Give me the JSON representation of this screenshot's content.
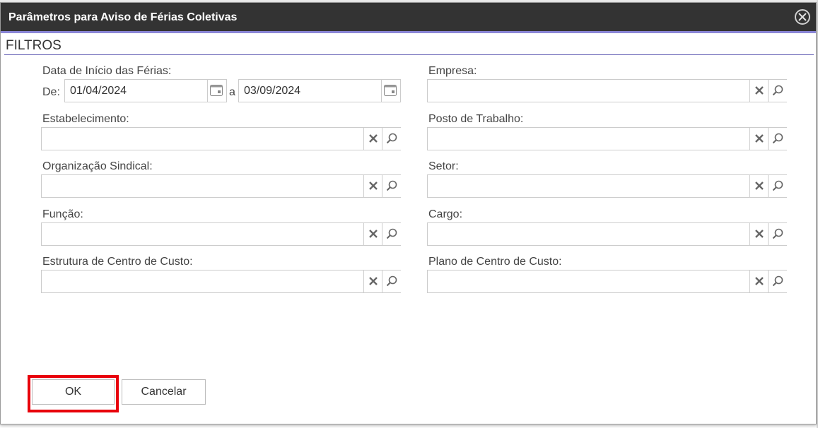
{
  "dialog": {
    "title": "Parâmetros para Aviso de Férias Coletivas",
    "close_icon": "close-circle-icon"
  },
  "section": {
    "title": "FILTROS"
  },
  "date_range": {
    "label": "Data de Início das Férias:",
    "from_label": "De:",
    "from_value": "01/04/2024",
    "to_label": "a",
    "to_value": "03/09/2024",
    "icon": "calendar-icon"
  },
  "filters": {
    "empresa": {
      "label": "Empresa:",
      "value": ""
    },
    "estabelecimento": {
      "label": "Estabelecimento:",
      "value": ""
    },
    "posto": {
      "label": "Posto de Trabalho:",
      "value": ""
    },
    "organizacao": {
      "label": "Organização Sindical:",
      "value": ""
    },
    "setor": {
      "label": "Setor:",
      "value": ""
    },
    "funcao": {
      "label": "Função:",
      "value": ""
    },
    "cargo": {
      "label": "Cargo:",
      "value": ""
    },
    "estrutura": {
      "label": "Estrutura de Centro de Custo:",
      "value": ""
    },
    "plano": {
      "label": "Plano de Centro de Custo:",
      "value": ""
    }
  },
  "icons": {
    "clear": "clear-x-icon",
    "search": "magnifier-icon"
  },
  "buttons": {
    "ok": "OK",
    "cancel": "Cancelar"
  },
  "colors": {
    "titlebar": "#333333",
    "accent": "#6b67b8",
    "highlight": "#e8000b"
  }
}
